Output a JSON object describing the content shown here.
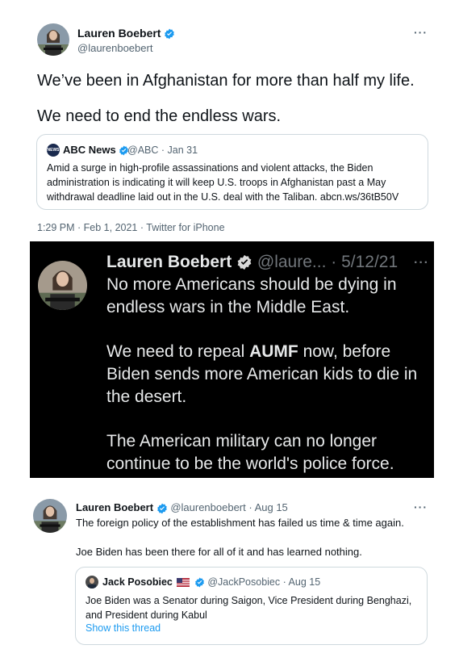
{
  "tweet1": {
    "author_name": "Lauren Boebert",
    "author_handle": "@laurenboebert",
    "line1": "We’ve been in Afghanistan for more than half my life.",
    "line2": "We need to end the endless wars.",
    "more": "···",
    "timestamp": "1:29 PM · Feb 1, 2021 · Twitter for iPhone",
    "quote": {
      "logo_text": "NEWS",
      "author_name": "ABC News",
      "meta": "@ABC · Jan 31",
      "text": "Amid a surge in high-profile assassinations and violent attacks, the Biden administration is indicating it will keep U.S. troops in Afghanistan past a May withdrawal deadline laid out in the U.S. deal with the Taliban. abcn.ws/36tB50V"
    }
  },
  "dark_tweet": {
    "author_name": "Lauren Boebert",
    "author_handle": "@laure...",
    "date": "· 5/12/21",
    "more": "···",
    "lines": [
      "No more Americans should be dying in",
      "endless wars in the Middle East.",
      "We need to repeal",
      "AUMF",
      "now, before",
      "Biden sends more American kids to die in",
      "the desert.",
      "The American military can no longer",
      "continue to be the world's police force."
    ]
  },
  "tweet3": {
    "author_name": "Lauren Boebert",
    "author_handle": "@laurenboebert · Aug 15",
    "more": "···",
    "p1": "The foreign policy of the establishment has failed us time & time again.",
    "p2": "Joe Biden has been there for all of it and has learned nothing.",
    "quote": {
      "author_name": "Jack Posobiec",
      "meta": "@JackPosobiec · Aug 15",
      "text": "Joe Biden was a Senator during Saigon, Vice President during Benghazi, and President during Kabul",
      "link": "Show this thread"
    }
  },
  "colors": {
    "verified": "#1d9bf0",
    "secondary_text": "#536471",
    "link": "#1d9bf0",
    "dark_bg": "#000000"
  }
}
